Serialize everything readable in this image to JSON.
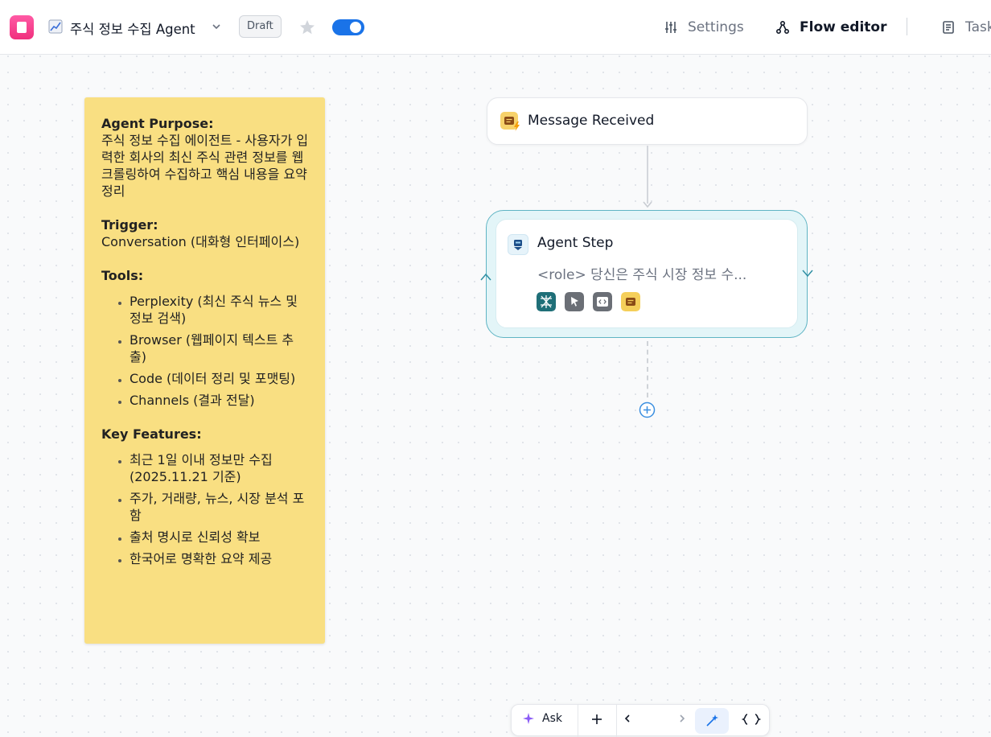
{
  "header": {
    "agent_emoji": "chart-increasing-icon",
    "agent_name": "주식 정보 수집 Agent",
    "status_badge": "Draft",
    "enabled": true,
    "nav": {
      "settings": "Settings",
      "flow_editor": "Flow editor",
      "tasks": "Task"
    }
  },
  "sticky_note": {
    "purpose_heading": "Agent Purpose:",
    "purpose_text": "주식 정보 수집 에이전트 - 사용자가 입력한 회사의 최신 주식 관련 정보를 웹크롤링하여 수집하고 핵심 내용을 요약 정리",
    "trigger_heading": "Trigger:",
    "trigger_text": "Conversation (대화형 인터페이스)",
    "tools_heading": "Tools:",
    "tools": [
      "Perplexity (최신 주식 뉴스 및 정보 검색)",
      "Browser (웹페이지 텍스트 추출)",
      "Code (데이터 정리 및 포맷팅)",
      "Channels (결과 전달)"
    ],
    "features_heading": "Key Features:",
    "features": [
      "최근 1일 이내 정보만 수집 (2025.11.21 기준)",
      "주가, 거래량, 뉴스, 시장 분석 포함",
      "출처 명시로 신뢰성 확보",
      "한국어로 명확한 요약 제공"
    ]
  },
  "flow": {
    "trigger_node": {
      "label": "Message Received",
      "icon": "message-lightning-icon"
    },
    "agent_node": {
      "title": "Agent Step",
      "description": "<role> 당신은 주식 시장 정보 수...",
      "tools": [
        {
          "name": "perplexity-tool-icon",
          "color": "#1f6f78"
        },
        {
          "name": "browser-tool-icon",
          "color": "#6b6f76"
        },
        {
          "name": "code-tool-icon",
          "color": "#6b6f76"
        },
        {
          "name": "channels-tool-icon",
          "color": "#f5cf5a"
        }
      ]
    }
  },
  "bottom_toolbar": {
    "label": "Ask"
  },
  "colors": {
    "accent": "#1a73e8",
    "sticky": "#f9df82",
    "agent_border": "#5fb4c4",
    "pink_logo": "#f0307d"
  }
}
